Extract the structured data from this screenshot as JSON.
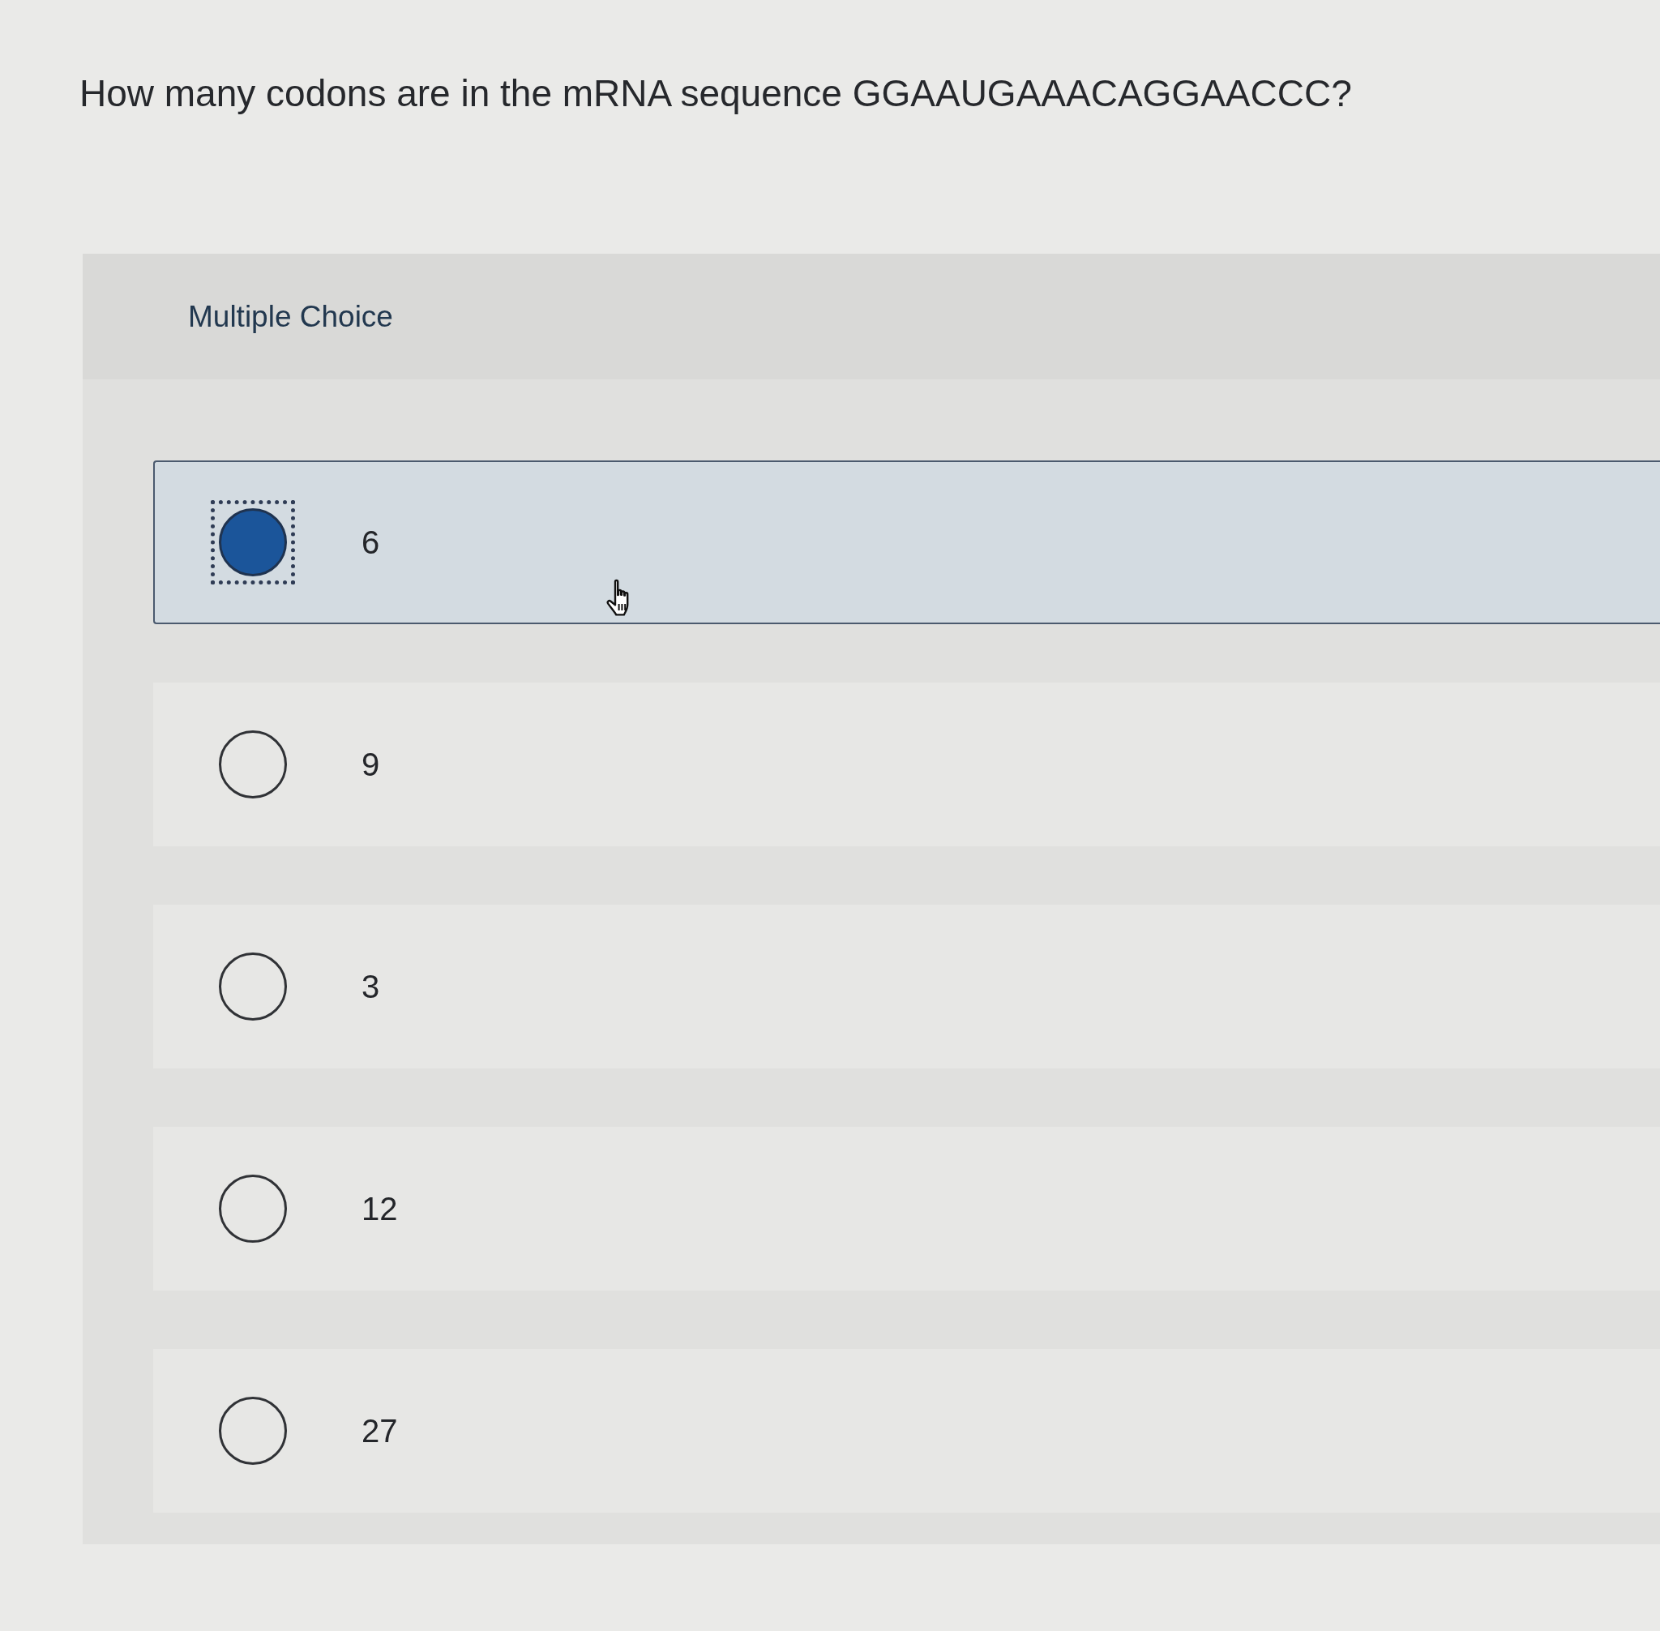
{
  "question": "How many codons are in the mRNA sequence GGAAUGAAACAGGAACCC?",
  "question_type": "Multiple Choice",
  "options": [
    {
      "label": "6",
      "selected": true
    },
    {
      "label": "9",
      "selected": false
    },
    {
      "label": "3",
      "selected": false
    },
    {
      "label": "12",
      "selected": false
    },
    {
      "label": "27",
      "selected": false
    }
  ]
}
